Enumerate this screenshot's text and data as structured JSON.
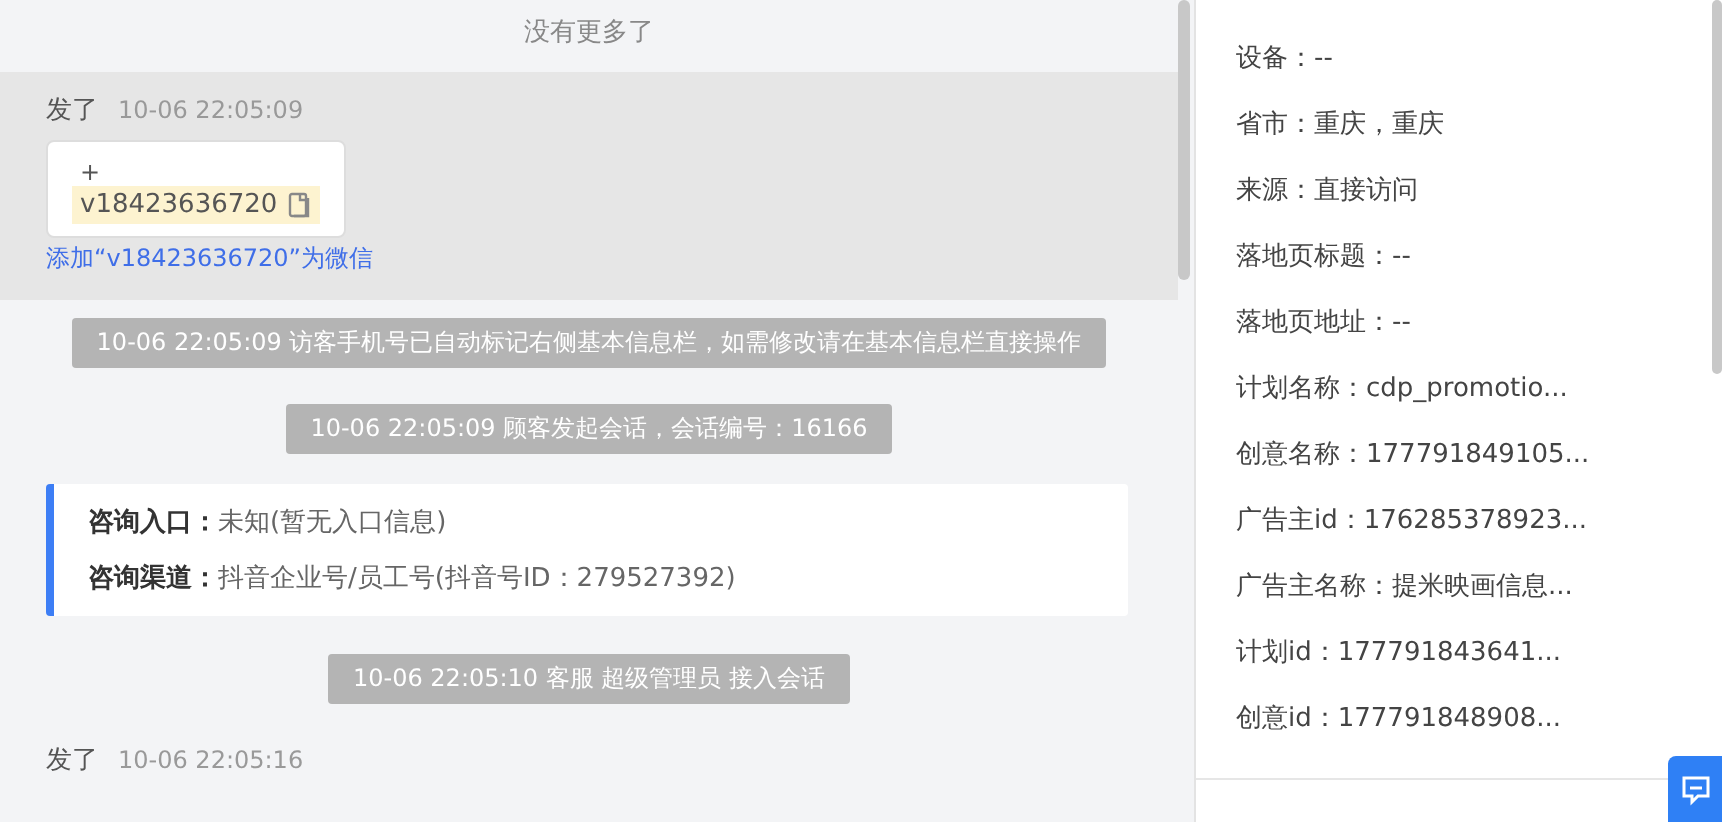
{
  "chat": {
    "no_more": "没有更多了",
    "timeline": [
      {
        "kind": "message",
        "sender": "发了",
        "time": "10-06 22:05:09",
        "highlighted": true,
        "card": {
          "plus": "+",
          "wechat": "v18423636720"
        },
        "link": "添加“v18423636720”为微信"
      },
      {
        "kind": "system",
        "text": "10-06 22:05:09 访客手机号已自动标记右侧基本信息栏，如需修改请在基本信息栏直接操作"
      },
      {
        "kind": "system",
        "text": "10-06 22:05:09 顾客发起会话，会话编号：16166"
      },
      {
        "kind": "info",
        "rows": [
          {
            "label": "咨询入口：",
            "value": "未知(暂无入口信息)"
          },
          {
            "label": "咨询渠道：",
            "value": "抖音企业号/员工号(抖音号ID：279527392)"
          }
        ]
      },
      {
        "kind": "system",
        "text": "10-06 22:05:10 客服 超级管理员 接入会话"
      },
      {
        "kind": "message",
        "sender": "发了",
        "time": "10-06 22:05:16"
      }
    ]
  },
  "details": [
    "设备：--",
    "省市：重庆，重庆",
    "来源：直接访问",
    "落地页标题：--",
    "落地页地址：--",
    "计划名称：cdp_promotio...",
    "创意名称：177791849105...",
    "广告主id：176285378923...",
    "广告主名称：提米映画信息...",
    "计划id：177791843641...",
    "创意id：177791848908..."
  ]
}
